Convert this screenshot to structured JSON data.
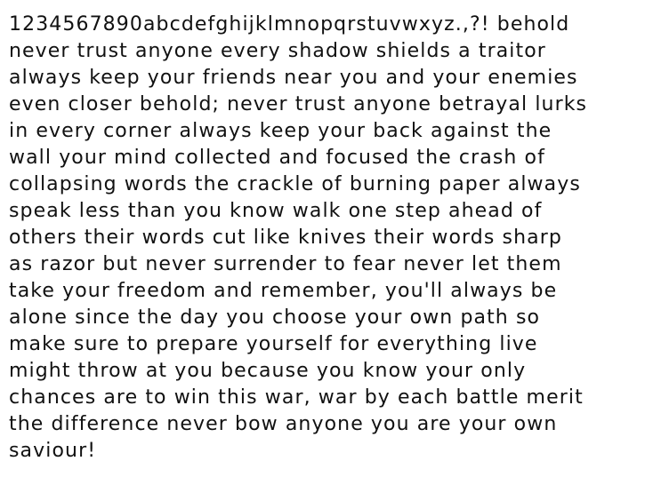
{
  "document": {
    "lines": [
      "1234567890abcdefghijklmnopqrstuvwxyz.,?! behold",
      "never trust anyone every shadow shields a traitor",
      "always keep your friends near you and your enemies",
      "even closer behold; never trust anyone betrayal lurks",
      "in every corner always keep your back against the",
      "wall your mind collected and focused the crash of",
      "collapsing words the crackle of burning paper always",
      "speak less than you know walk one step ahead of",
      "others their words cut like knives their words sharp",
      "as razor but never surrender to fear never let them",
      "take your freedom and remember, you'll always be",
      "alone since the day you choose your own path so",
      "make sure to prepare yourself for everything live",
      "might throw at you because you know your only",
      "chances are to win this war, war by each battle merit",
      "the difference never bow anyone you are your own",
      "saviour!"
    ]
  }
}
